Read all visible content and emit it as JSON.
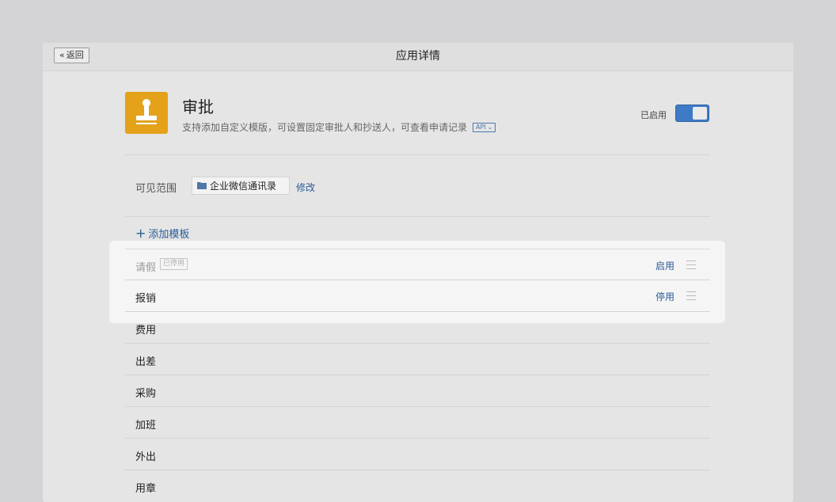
{
  "titlebar": {
    "back_label": "返回",
    "title": "应用详情"
  },
  "app": {
    "name": "审批",
    "description": "支持添加自定义模版，可设置固定审批人和抄送人，可查看申请记录",
    "api_tag": "API",
    "icon_color": "#e3a21a"
  },
  "status": {
    "enabled_label": "已启用",
    "toggle_on": true,
    "accent_color": "#3f7ac6"
  },
  "scope": {
    "label": "可见范围",
    "value": "企业微信通讯录",
    "modify_label": "修改"
  },
  "templates": {
    "add_label": "添加模板",
    "rows": [
      {
        "name": "请假",
        "status": "已停用",
        "action": "启用"
      },
      {
        "name": "报销",
        "action": "停用"
      },
      {
        "name": "费用"
      },
      {
        "name": "出差"
      },
      {
        "name": "采购"
      },
      {
        "name": "加班"
      },
      {
        "name": "外出"
      },
      {
        "name": "用章"
      }
    ]
  }
}
